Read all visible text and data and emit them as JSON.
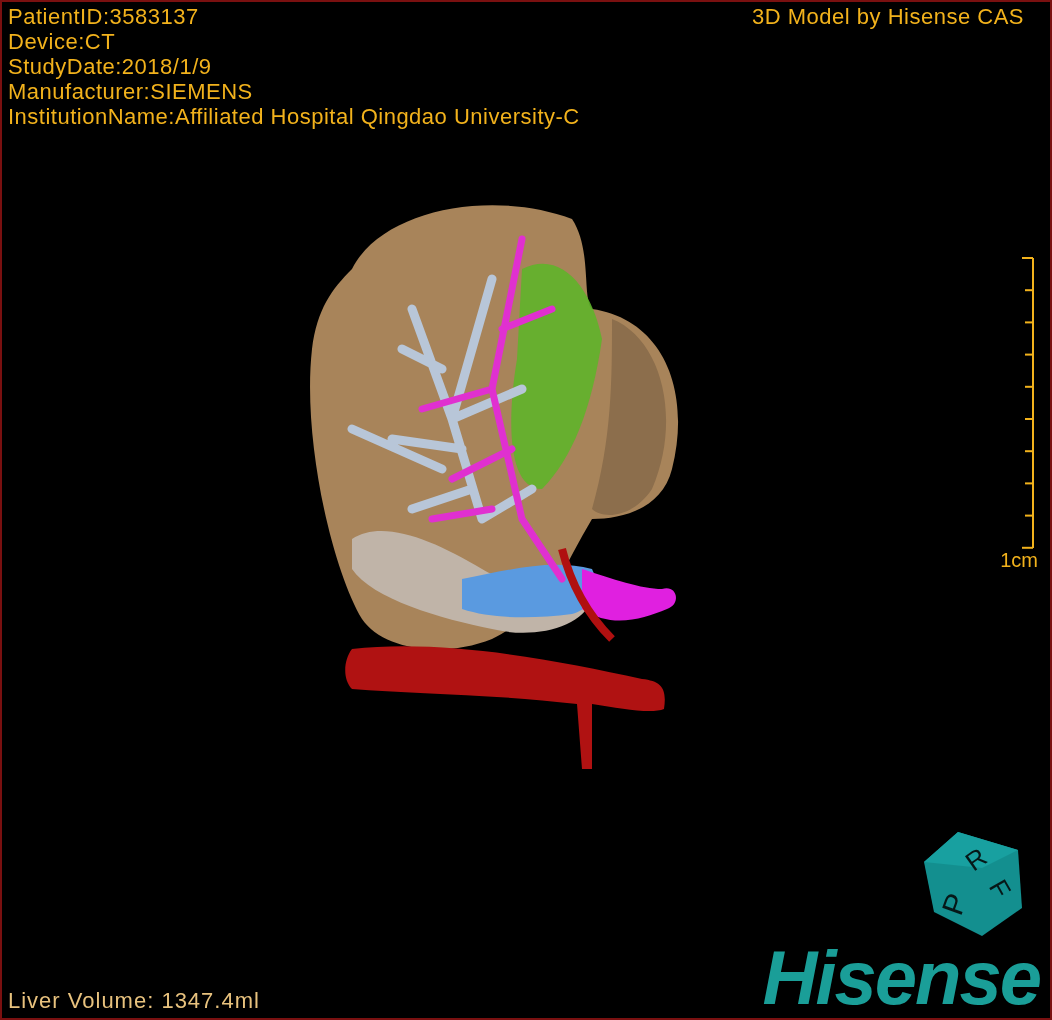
{
  "header": {
    "info": [
      "PatientID:3583137",
      "Device:CT",
      "StudyDate:2018/1/9",
      "Manufacturer:SIEMENS",
      "InstitutionName:Affiliated Hospital Qingdao University-C"
    ],
    "title": "3D Model by Hisense CAS"
  },
  "scale_bar": {
    "label": "1cm"
  },
  "orientation_cube": {
    "labels": [
      "P",
      "R",
      "F"
    ]
  },
  "footer": {
    "liver_volume": "Liver Volume: 1347.4ml",
    "logo": "Hisense"
  }
}
